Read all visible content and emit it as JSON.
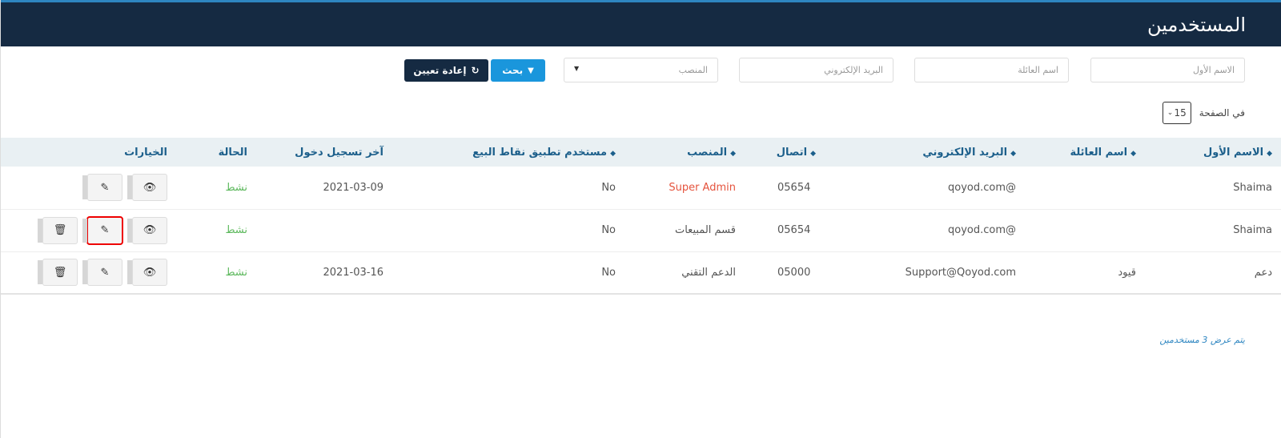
{
  "header": {
    "title": "المستخدمين"
  },
  "filters": {
    "first_name_placeholder": "الاسم الأول",
    "last_name_placeholder": "اسم العائلة",
    "email_placeholder": "البريد الإلكتروني",
    "role_select": "المنصب",
    "search_label": "بحث",
    "reset_label": "إعادة تعيين"
  },
  "per_page": {
    "label": "في الصفحة",
    "value": "15"
  },
  "table": {
    "headers": [
      "الاسم الأول",
      "اسم العائلة",
      "البريد الإلكتروني",
      "اتصال",
      "المنصب",
      "مستخدم تطبيق نقاط البيع",
      "آخر تسجيل دخول",
      "الحالة",
      "الخيارات"
    ],
    "rows": [
      {
        "first_name": "Shaima",
        "last_name": "",
        "email": "@qoyod.com",
        "phone": "05654",
        "role": "Super Admin",
        "pos_user": "No",
        "last_login": "2021-03-09",
        "status": "نشط"
      },
      {
        "first_name": "Shaima",
        "last_name": "",
        "email": "@qoyod.com",
        "phone": "05654",
        "role": "قسم المبيعات",
        "pos_user": "No",
        "last_login": "",
        "status": "نشط"
      },
      {
        "first_name": "دعم",
        "last_name": "قيود",
        "email": "Support@Qoyod.com",
        "phone": "05000",
        "role": "الدعم التقني",
        "pos_user": "No",
        "last_login": "2021-03-16",
        "status": "نشط"
      }
    ]
  },
  "footer": {
    "summary": "يتم عرض 3 مستخدمين"
  },
  "colors": {
    "header_bg": "#152a42",
    "accent": "#2e86c1",
    "active": "#5cb85c",
    "admin": "#e5533d",
    "highlight": "#e00000"
  }
}
